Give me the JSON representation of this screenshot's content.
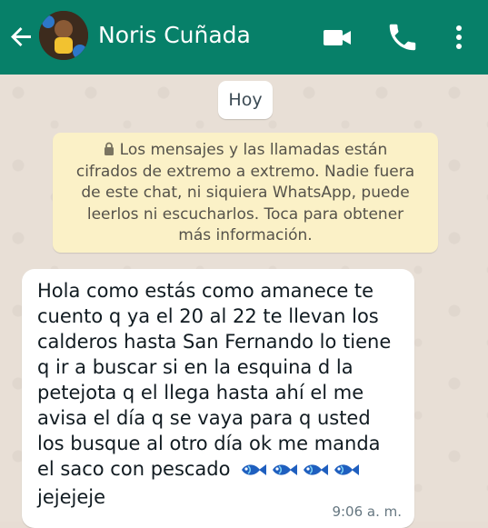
{
  "header": {
    "title": "Noris Cuñada",
    "back_icon": "arrow-left-icon",
    "avatar": "contact-avatar",
    "actions": [
      "video-call-icon",
      "phone-icon",
      "more-vertical-icon"
    ],
    "bar_color": "#078069"
  },
  "chat": {
    "date_label": "Hoy",
    "encryption_notice": "Los mensajes y las llamadas están cifrados de extremo a extremo. Nadie fuera de este chat, ni siquiera WhatsApp, puede leerlos ni escucharlos. Toca para obtener más información.",
    "message": {
      "text_lines": [
        "Hola como estás como amanece te",
        "cuento q ya el 20 al 22 te llevan los",
        "calderos hasta San Fernando lo tiene",
        "q ir a buscar si en la esquina d la",
        "petejota q el llega hasta ahí el me",
        "avisa el día q se vaya para q usted",
        "los busque al otro día ok me manda",
        "el saco con pescado",
        "jejejeje"
      ],
      "emojis": [
        "fish-emoji",
        "fish-emoji",
        "fish-emoji",
        "fish-emoji"
      ],
      "time": "9:06 a. m."
    }
  }
}
